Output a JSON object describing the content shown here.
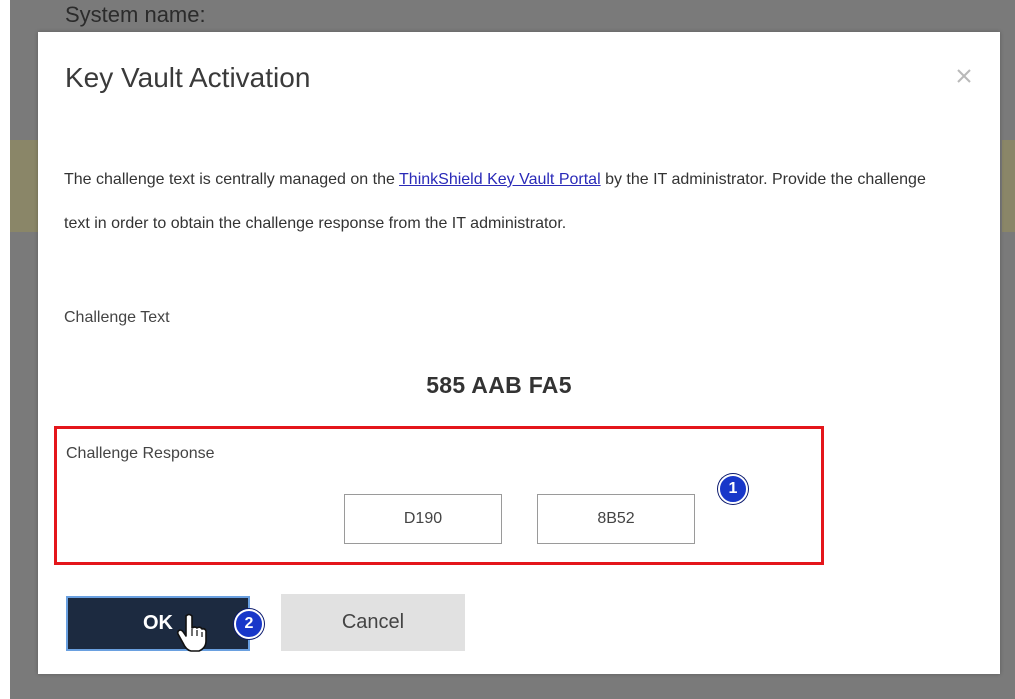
{
  "background": {
    "system_name_label": "System name:"
  },
  "dialog": {
    "title": "Key Vault Activation",
    "close_icon": "close-icon",
    "description": {
      "part1": "The challenge text is centrally managed on the ",
      "link_text": "ThinkShield Key Vault Portal",
      "part2": " by the IT administrator. Provide the challenge text in order to obtain the challenge response from the IT administrator."
    },
    "challenge_text_label": "Challenge Text",
    "challenge_code": "585 AAB FA5",
    "challenge_response_label": "Challenge Response",
    "response_fields": [
      "D190",
      "8B52"
    ],
    "ok_label": "OK",
    "cancel_label": "Cancel"
  },
  "annotations": {
    "callout_1": "1",
    "callout_2": "2",
    "highlight_color": "#e4161b",
    "callout_color": "#1837c9"
  }
}
